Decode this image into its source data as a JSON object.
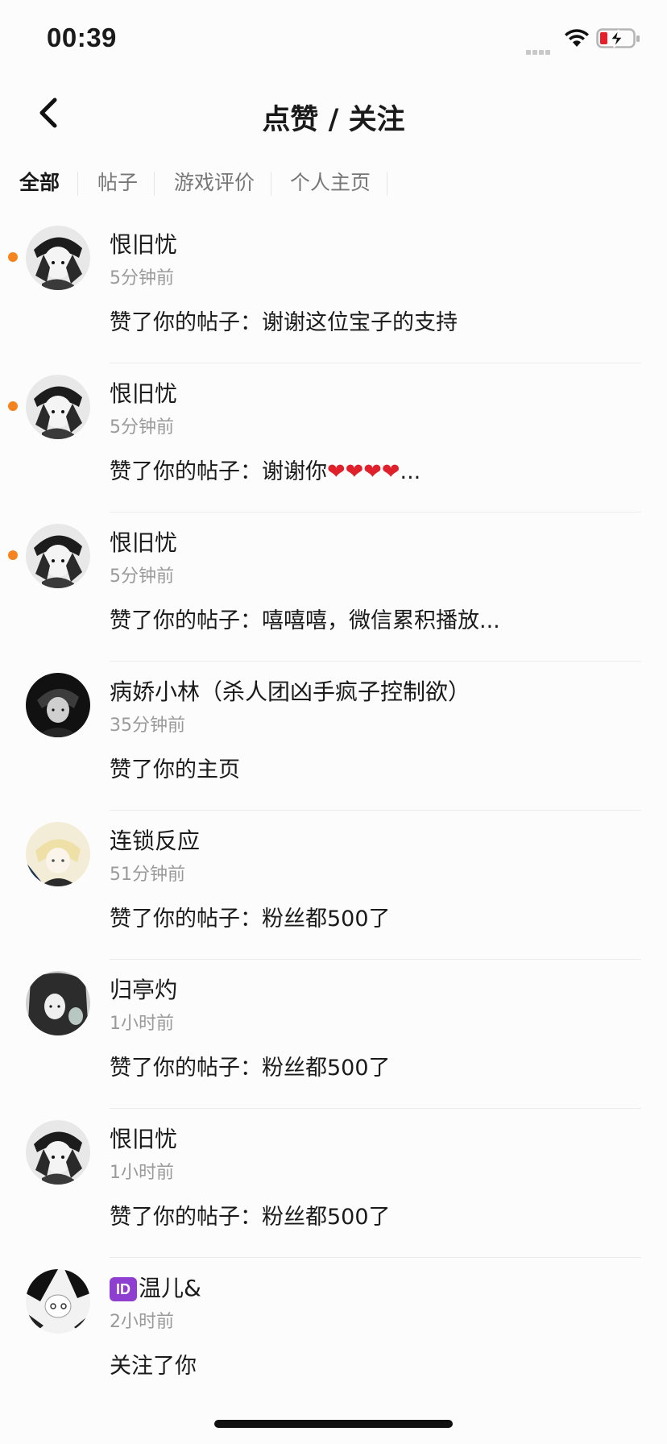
{
  "status_bar": {
    "time": "00:39"
  },
  "nav": {
    "title": "点赞 / 关注"
  },
  "tabs": [
    {
      "label": "全部",
      "active": true
    },
    {
      "label": "帖子",
      "active": false
    },
    {
      "label": "游戏评价",
      "active": false
    },
    {
      "label": "个人主页",
      "active": false
    }
  ],
  "notifications": [
    {
      "name": "恨旧忧",
      "time": "5分钟前",
      "action": "赞了你的帖子：谢谢这位宝子的支持",
      "unread": true
    },
    {
      "name": "恨旧忧",
      "time": "5分钟前",
      "action_prefix": "赞了你的帖子：谢谢你",
      "action_hearts": "❤❤❤❤",
      "action_suffix": "...",
      "unread": true
    },
    {
      "name": "恨旧忧",
      "time": "5分钟前",
      "action": "赞了你的帖子：嘻嘻嘻，微信累积播放...",
      "unread": true
    },
    {
      "name": "病娇小林（杀人团凶手疯子控制欲）",
      "time": "35分钟前",
      "action": "赞了你的主页",
      "unread": false
    },
    {
      "name": "连锁反应",
      "time": "51分钟前",
      "action": "赞了你的帖子：粉丝都500了",
      "unread": false
    },
    {
      "name": "归亭灼",
      "time": "1小时前",
      "action": "赞了你的帖子：粉丝都500了",
      "unread": false
    },
    {
      "name": "恨旧忧",
      "time": "1小时前",
      "action": "赞了你的帖子：粉丝都500了",
      "unread": false
    },
    {
      "name_badge": "ID",
      "name": "温儿&",
      "time": "2小时前",
      "action": "关注了你",
      "unread": false
    }
  ],
  "colors": {
    "unread_dot": "#f5841f",
    "heart": "#e0202a",
    "id_badge": "#8e3fd0"
  }
}
